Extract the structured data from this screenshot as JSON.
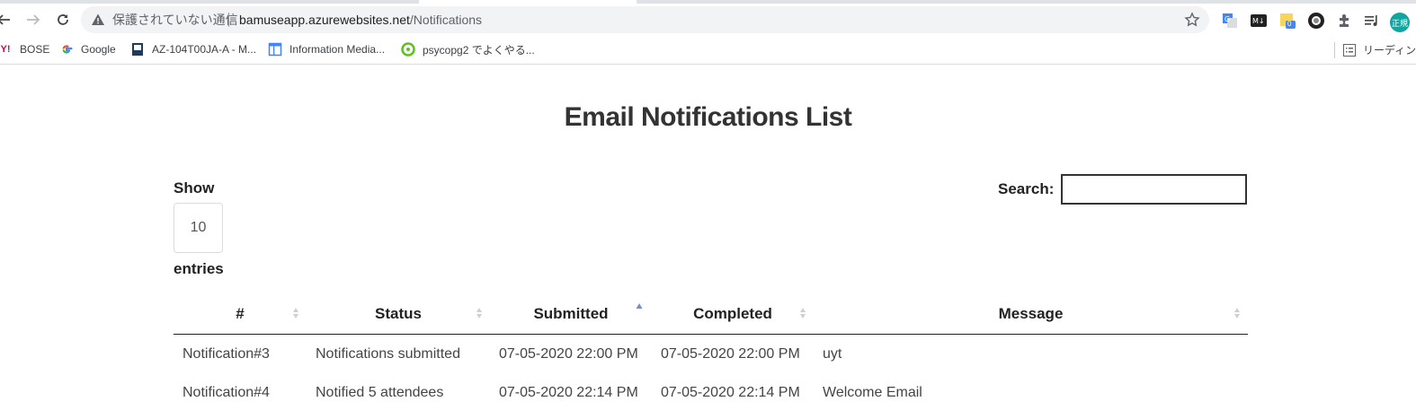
{
  "browser": {
    "security_label": "保護されていない通信",
    "url_host": "bamuseapp.azurewebsites.net",
    "url_path": "/Notifications",
    "profile_initials": "正規",
    "extension_badge": "0",
    "bookmarks": [
      {
        "label": "BOSE",
        "icon": "yahoo-icon"
      },
      {
        "label": "Google",
        "icon": "google-icon"
      },
      {
        "label": "AZ-104T00JA-A - M...",
        "icon": "book-icon"
      },
      {
        "label": "Information Media...",
        "icon": "layout-icon"
      },
      {
        "label": "psycopg2 でよくやる...",
        "icon": "green-ring-icon"
      }
    ],
    "reading_list_label": "リーディング"
  },
  "page": {
    "title": "Email Notifications List",
    "show_label": "Show",
    "page_length": "10",
    "entries_label": "entries",
    "search_label": "Search:",
    "search_value": ""
  },
  "table": {
    "columns": [
      "#",
      "Status",
      "Submitted",
      "Completed",
      "Message"
    ],
    "sorted_column": "Submitted",
    "sort_direction": "ascending",
    "rows": [
      [
        "Notification#3",
        "Notifications submitted",
        "07-05-2020 22:00 PM",
        "07-05-2020 22:00 PM",
        "uyt"
      ],
      [
        "Notification#4",
        "Notified 5 attendees",
        "07-05-2020 22:14 PM",
        "07-05-2020 22:14 PM",
        "Welcome Email"
      ]
    ]
  },
  "colors": {
    "sort_active": "#7a8bd6",
    "sort_inactive": "#cfcfcf",
    "profile": "#12a4a0"
  }
}
